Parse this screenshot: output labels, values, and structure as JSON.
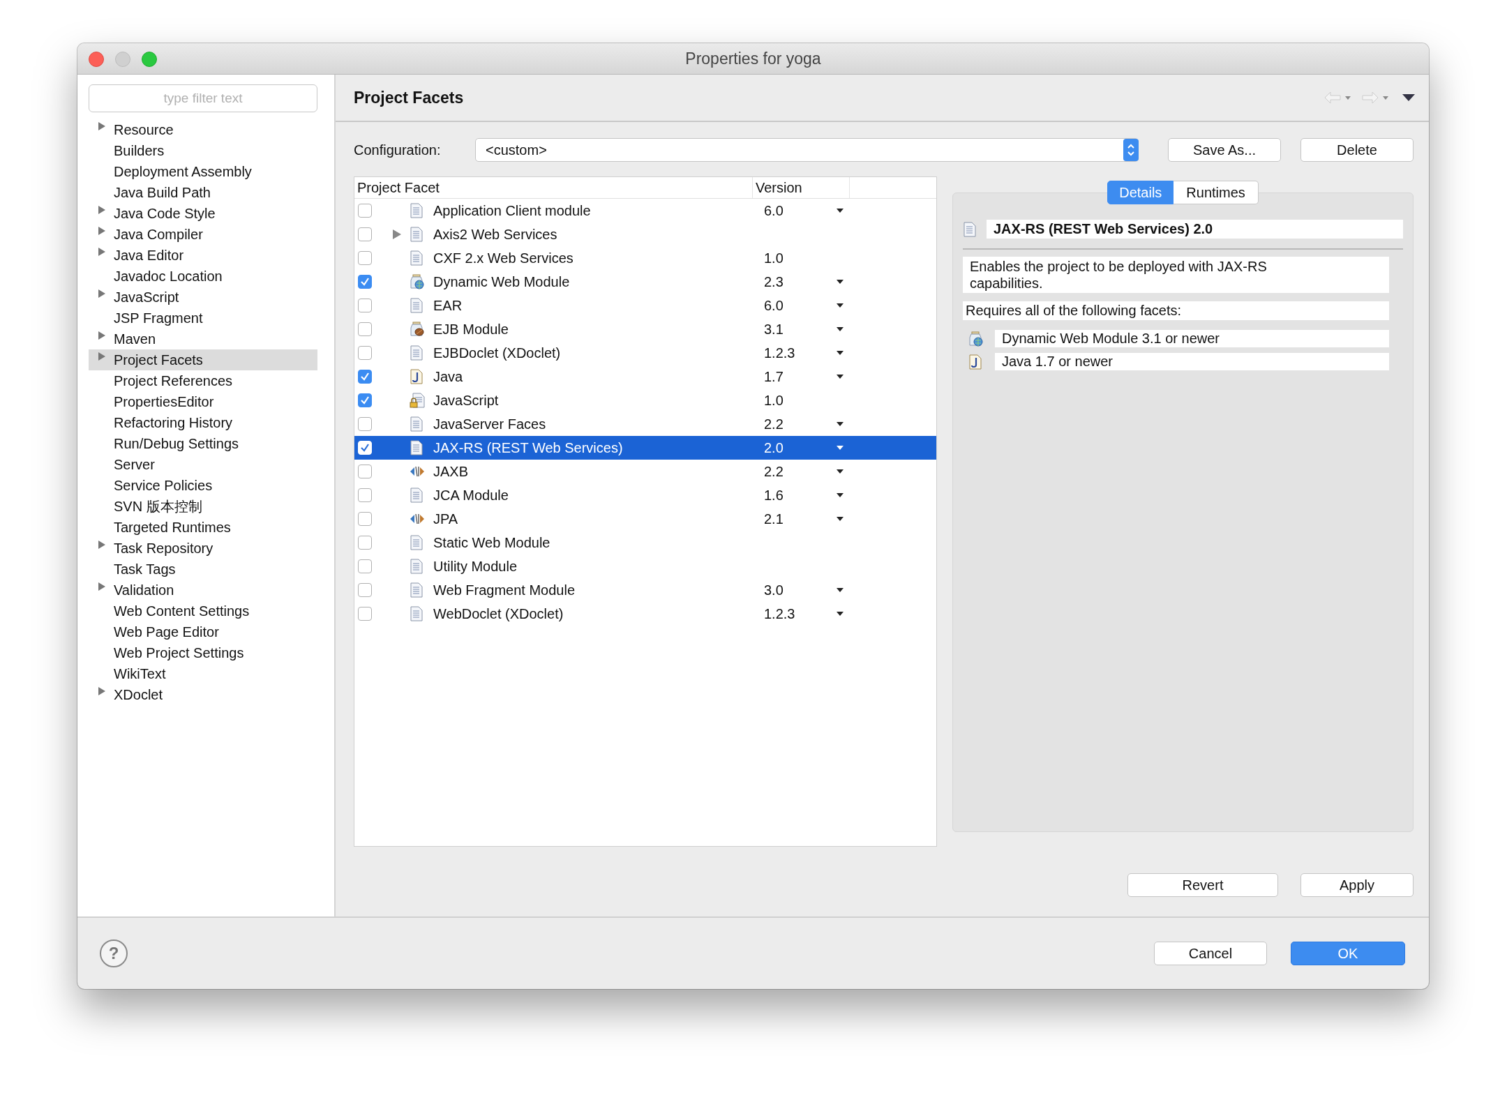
{
  "window": {
    "title": "Properties for yoga"
  },
  "sidebar": {
    "filter_placeholder": "type filter text",
    "items": [
      {
        "label": "Resource",
        "expandable": true,
        "selected": false
      },
      {
        "label": "Builders",
        "expandable": false,
        "selected": false
      },
      {
        "label": "Deployment Assembly",
        "expandable": false,
        "selected": false
      },
      {
        "label": "Java Build Path",
        "expandable": false,
        "selected": false
      },
      {
        "label": "Java Code Style",
        "expandable": true,
        "selected": false
      },
      {
        "label": "Java Compiler",
        "expandable": true,
        "selected": false
      },
      {
        "label": "Java Editor",
        "expandable": true,
        "selected": false
      },
      {
        "label": "Javadoc Location",
        "expandable": false,
        "selected": false
      },
      {
        "label": "JavaScript",
        "expandable": true,
        "selected": false
      },
      {
        "label": "JSP Fragment",
        "expandable": false,
        "selected": false
      },
      {
        "label": "Maven",
        "expandable": true,
        "selected": false
      },
      {
        "label": "Project Facets",
        "expandable": true,
        "selected": true
      },
      {
        "label": "Project References",
        "expandable": false,
        "selected": false
      },
      {
        "label": "PropertiesEditor",
        "expandable": false,
        "selected": false
      },
      {
        "label": "Refactoring History",
        "expandable": false,
        "selected": false
      },
      {
        "label": "Run/Debug Settings",
        "expandable": false,
        "selected": false
      },
      {
        "label": "Server",
        "expandable": false,
        "selected": false
      },
      {
        "label": "Service Policies",
        "expandable": false,
        "selected": false
      },
      {
        "label": "SVN 版本控制",
        "expandable": false,
        "selected": false
      },
      {
        "label": "Targeted Runtimes",
        "expandable": false,
        "selected": false
      },
      {
        "label": "Task Repository",
        "expandable": true,
        "selected": false
      },
      {
        "label": "Task Tags",
        "expandable": false,
        "selected": false
      },
      {
        "label": "Validation",
        "expandable": true,
        "selected": false
      },
      {
        "label": "Web Content Settings",
        "expandable": false,
        "selected": false
      },
      {
        "label": "Web Page Editor",
        "expandable": false,
        "selected": false
      },
      {
        "label": "Web Project Settings",
        "expandable": false,
        "selected": false
      },
      {
        "label": "WikiText",
        "expandable": false,
        "selected": false
      },
      {
        "label": "XDoclet",
        "expandable": true,
        "selected": false
      }
    ]
  },
  "page": {
    "title": "Project Facets"
  },
  "configuration": {
    "label": "Configuration:",
    "value": "<custom>",
    "buttons": [
      "Save As...",
      "Delete"
    ]
  },
  "table": {
    "columns": [
      "Project Facet",
      "Version"
    ],
    "rows": [
      {
        "name": "Application Client module",
        "kind": "doc",
        "checked": false,
        "selected": false,
        "expandable": false,
        "version": "6.0",
        "has_dropdown": true
      },
      {
        "name": "Axis2 Web Services",
        "kind": "doc",
        "checked": false,
        "selected": false,
        "expandable": true,
        "has_dropdown": false
      },
      {
        "name": "CXF 2.x Web Services",
        "kind": "doc",
        "checked": false,
        "selected": false,
        "expandable": false,
        "version": "1.0",
        "has_dropdown": false
      },
      {
        "name": "Dynamic Web Module",
        "kind": "web",
        "checked": true,
        "selected": false,
        "expandable": false,
        "version": "2.3",
        "has_dropdown": true
      },
      {
        "name": "EAR",
        "kind": "doc",
        "checked": false,
        "selected": false,
        "expandable": false,
        "version": "6.0",
        "has_dropdown": true
      },
      {
        "name": "EJB Module",
        "kind": "ejb",
        "checked": false,
        "selected": false,
        "expandable": false,
        "version": "3.1",
        "has_dropdown": true
      },
      {
        "name": "EJBDoclet (XDoclet)",
        "kind": "doc",
        "checked": false,
        "selected": false,
        "expandable": false,
        "version": "1.2.3",
        "has_dropdown": true
      },
      {
        "name": "Java",
        "kind": "java",
        "checked": true,
        "selected": false,
        "expandable": false,
        "version": "1.7",
        "has_dropdown": true
      },
      {
        "name": "JavaScript",
        "kind": "locked",
        "checked": true,
        "selected": false,
        "expandable": false,
        "version": "1.0",
        "has_dropdown": false
      },
      {
        "name": "JavaServer Faces",
        "kind": "doc",
        "checked": false,
        "selected": false,
        "expandable": false,
        "version": "2.2",
        "has_dropdown": true
      },
      {
        "name": "JAX-RS (REST Web Services)",
        "kind": "doc",
        "checked": true,
        "selected": true,
        "expandable": false,
        "version": "2.0",
        "has_dropdown": true
      },
      {
        "name": "JAXB",
        "kind": "xml",
        "checked": false,
        "selected": false,
        "expandable": false,
        "version": "2.2",
        "has_dropdown": true
      },
      {
        "name": "JCA Module",
        "kind": "doc",
        "checked": false,
        "selected": false,
        "expandable": false,
        "version": "1.6",
        "has_dropdown": true
      },
      {
        "name": "JPA",
        "kind": "xml",
        "checked": false,
        "selected": false,
        "expandable": false,
        "version": "2.1",
        "has_dropdown": true
      },
      {
        "name": "Static Web Module",
        "kind": "doc",
        "checked": false,
        "selected": false,
        "expandable": false,
        "has_dropdown": false
      },
      {
        "name": "Utility Module",
        "kind": "doc",
        "checked": false,
        "selected": false,
        "expandable": false,
        "has_dropdown": false
      },
      {
        "name": "Web Fragment Module",
        "kind": "doc",
        "checked": false,
        "selected": false,
        "expandable": false,
        "version": "3.0",
        "has_dropdown": true
      },
      {
        "name": "WebDoclet (XDoclet)",
        "kind": "doc",
        "checked": false,
        "selected": false,
        "expandable": false,
        "version": "1.2.3",
        "has_dropdown": true
      }
    ]
  },
  "details": {
    "tabs": [
      {
        "label": "Details",
        "selected": true
      },
      {
        "label": "Runtimes",
        "selected": false
      }
    ],
    "kind": "doc",
    "title": "JAX-RS (REST Web Services) 2.0",
    "description": "Enables the project to be deployed with JAX-RS capabilities.",
    "requires_label": "Requires all of the following facets:",
    "requirements": [
      {
        "kind": "web",
        "text": "Dynamic Web Module 3.1 or newer"
      },
      {
        "kind": "java",
        "text": "Java 1.7 or newer"
      }
    ]
  },
  "page_buttons": [
    "Revert",
    "Apply"
  ],
  "help_button": "?",
  "dialog_buttons": [
    {
      "label": "Cancel",
      "default": false
    },
    {
      "label": "OK",
      "default": true
    }
  ]
}
